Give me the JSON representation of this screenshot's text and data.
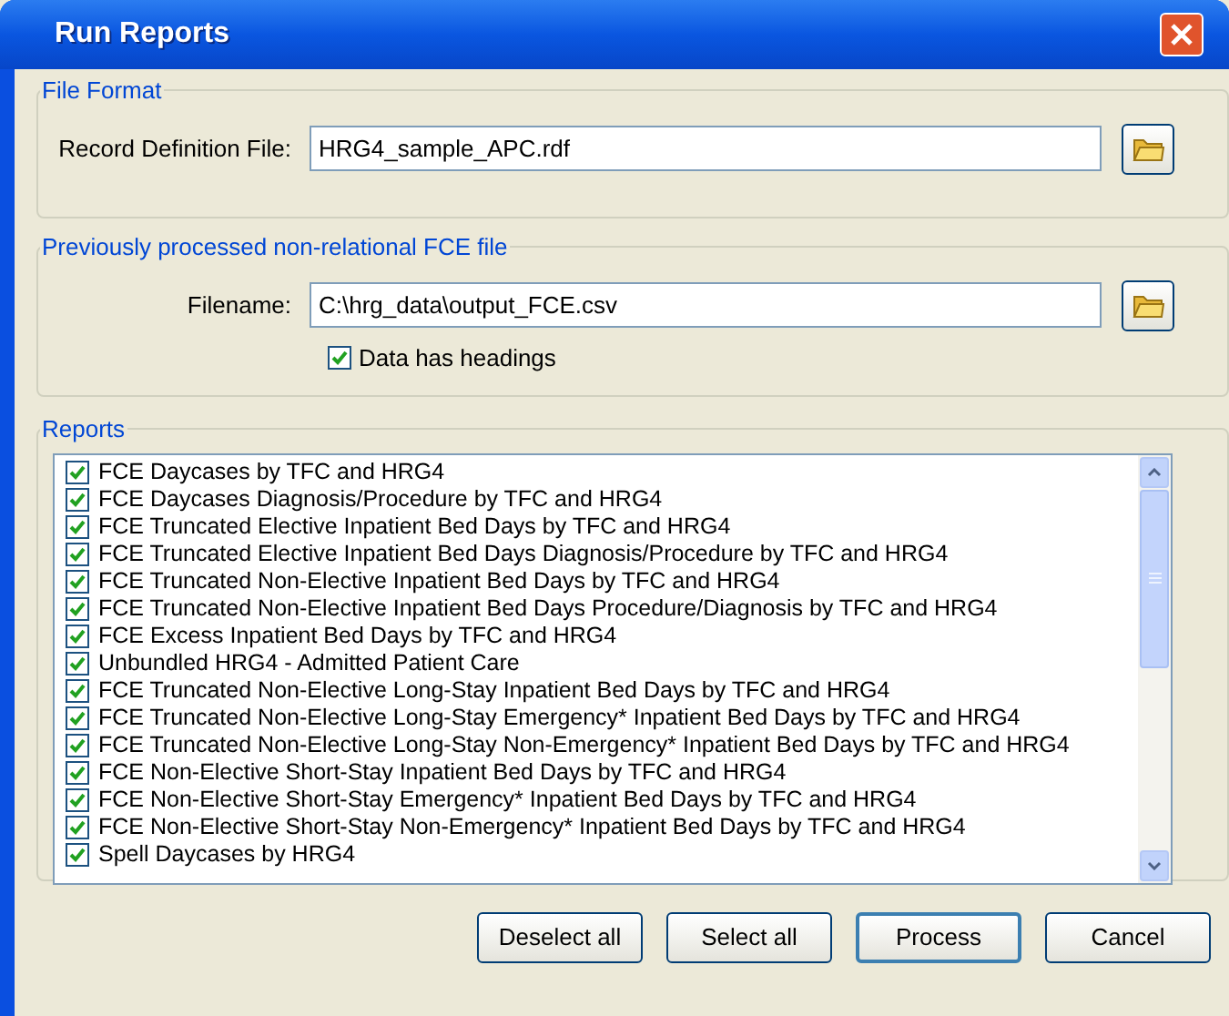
{
  "window": {
    "title": "Run Reports"
  },
  "file_format": {
    "title": "File Format",
    "label": "Record Definition File:",
    "value": "HRG4_sample_APC.rdf"
  },
  "fce_file": {
    "title": "Previously processed non-relational FCE file",
    "label": "Filename:",
    "value": "C:\\hrg_data\\output_FCE.csv",
    "headings": {
      "label": "Data has headings",
      "checked": true
    }
  },
  "reports": {
    "title": "Reports",
    "items": [
      {
        "label": "FCE Daycases by TFC and HRG4",
        "checked": true
      },
      {
        "label": "FCE Daycases Diagnosis/Procedure by TFC and HRG4",
        "checked": true
      },
      {
        "label": "FCE Truncated Elective Inpatient Bed Days by TFC and HRG4",
        "checked": true
      },
      {
        "label": "FCE Truncated Elective Inpatient Bed Days Diagnosis/Procedure by TFC and HRG4",
        "checked": true
      },
      {
        "label": "FCE Truncated Non-Elective Inpatient Bed Days by TFC and HRG4",
        "checked": true
      },
      {
        "label": "FCE Truncated Non-Elective Inpatient Bed Days Procedure/Diagnosis by TFC and HRG4",
        "checked": true
      },
      {
        "label": "FCE Excess Inpatient Bed Days by TFC and HRG4",
        "checked": true
      },
      {
        "label": "Unbundled HRG4 - Admitted Patient Care",
        "checked": true
      },
      {
        "label": "FCE Truncated Non-Elective Long-Stay Inpatient Bed Days by TFC and HRG4",
        "checked": true
      },
      {
        "label": "FCE Truncated Non-Elective Long-Stay Emergency* Inpatient Bed Days by TFC and HRG4",
        "checked": true
      },
      {
        "label": "FCE Truncated Non-Elective Long-Stay Non-Emergency* Inpatient Bed Days by TFC and HRG4",
        "checked": true
      },
      {
        "label": "FCE Non-Elective Short-Stay Inpatient Bed Days by TFC and HRG4",
        "checked": true
      },
      {
        "label": "FCE Non-Elective Short-Stay Emergency* Inpatient Bed Days by TFC and HRG4",
        "checked": true
      },
      {
        "label": "FCE Non-Elective Short-Stay Non-Emergency* Inpatient Bed Days by TFC and HRG4",
        "checked": true
      },
      {
        "label": "Spell Daycases by HRG4",
        "checked": true
      }
    ]
  },
  "buttons": [
    {
      "label": "Deselect all",
      "default": false
    },
    {
      "label": "Select all",
      "default": false
    },
    {
      "label": "Process",
      "default": true
    },
    {
      "label": "Cancel",
      "default": false
    }
  ]
}
